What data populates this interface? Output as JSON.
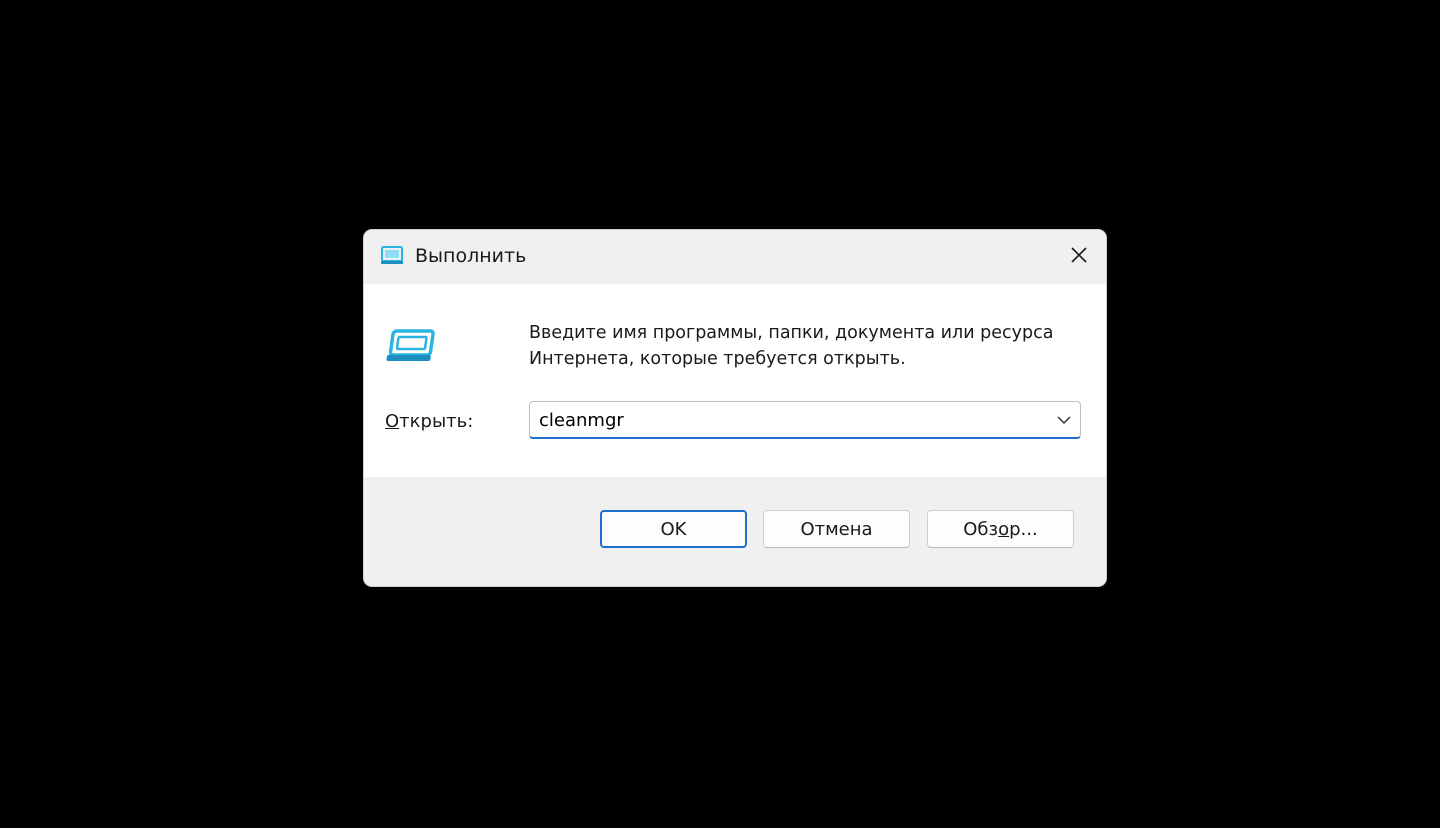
{
  "window": {
    "title": "Выполнить",
    "icon": "run-icon",
    "close_icon": "close-icon"
  },
  "content": {
    "icon": "run-icon",
    "description": "Введите имя программы, папки, документа или ресурса Интернета, которые требуется открыть."
  },
  "open_field": {
    "label_accel": "О",
    "label_rest": "ткрыть:",
    "value": "cleanmgr",
    "dropdown_icon": "chevron-down-icon"
  },
  "buttons": {
    "ok": "OK",
    "cancel": "Отмена",
    "browse_pre": "Обз",
    "browse_accel": "о",
    "browse_post": "р..."
  },
  "colors": {
    "accent": "#1f6fcc",
    "icon_cyan": "#2ab4e0"
  }
}
